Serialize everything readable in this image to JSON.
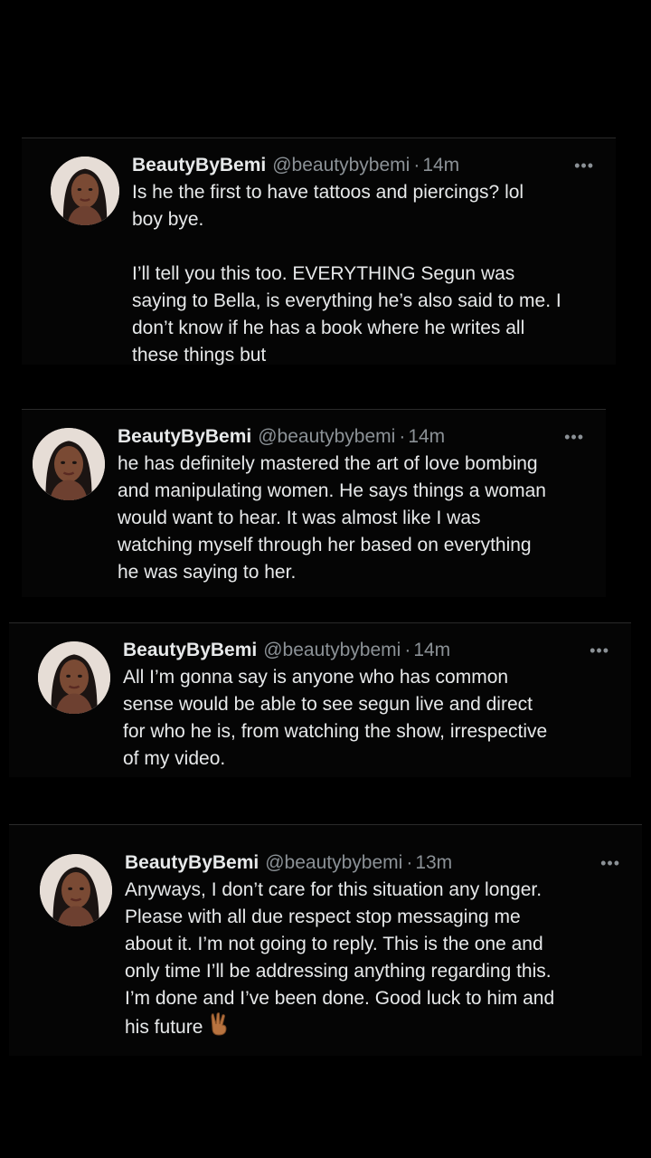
{
  "colors": {
    "background": "#000000",
    "card": "#050505",
    "name_text": "#e7e9ea",
    "meta_text": "#8b9196"
  },
  "tweets": [
    {
      "display_name": "BeautyByBemi",
      "handle": "@beautybybemi",
      "separator": "·",
      "time": "14m",
      "more": "•••",
      "text": "Is he the first to have tattoos and piercings? lol\nboy bye.\n\nI’ll tell you this too. EVERYTHING Segun was\nsaying to Bella, is everything he’s also said to me. I\ndon’t know if he has a book where he writes all\nthese things but"
    },
    {
      "display_name": "BeautyByBemi",
      "handle": "@beautybybemi",
      "separator": "·",
      "time": "14m",
      "more": "•••",
      "text": "he has definitely mastered the art of love bombing\nand manipulating women. He says things a woman\nwould want to hear. It was almost like I was\nwatching myself through her based on everything\nhe was saying to her."
    },
    {
      "display_name": "BeautyByBemi",
      "handle": "@beautybybemi",
      "separator": "·",
      "time": "14m",
      "more": "•••",
      "text": "All I’m gonna say is anyone who has common\nsense would be able to see segun live and direct\nfor who he is, from watching the show, irrespective\nof my video."
    },
    {
      "display_name": "BeautyByBemi",
      "handle": "@beautybybemi",
      "separator": "·",
      "time": "13m",
      "more": "•••",
      "text": "Anyways, I don’t care for this situation any longer.\nPlease with all due respect stop messaging me\nabout it. I’m not going to reply. This is the one and\nonly time I’ll be addressing anything regarding this.\nI’m done and I’ve been done. Good luck to him and\nhis future",
      "emoji": "victory-hand-icon"
    }
  ]
}
